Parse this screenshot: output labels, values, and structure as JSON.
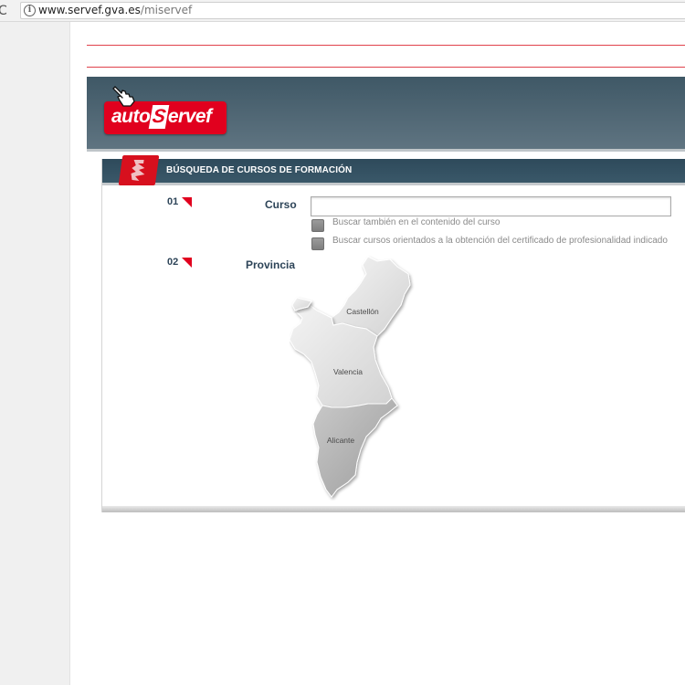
{
  "browser": {
    "url_domain": "www.servef.gva.es",
    "url_path": "/miservef"
  },
  "logo": {
    "text_before": "auto",
    "text_s": "S",
    "text_after": "ervef"
  },
  "panel": {
    "title": "BÚSQUEDA DE CURSOS DE FORMACIÓN",
    "step1": {
      "number": "01",
      "label": "Curso",
      "input_value": "",
      "options": [
        {
          "label": "Buscar también en el contenido del curso"
        },
        {
          "label": "Buscar cursos orientados a la obtención del certificado de profesionalidad indicado"
        }
      ]
    },
    "step2": {
      "number": "02",
      "label": "Provincia",
      "provinces": [
        {
          "name": "Castellón"
        },
        {
          "name": "Valencia"
        },
        {
          "name": "Alicante"
        }
      ]
    }
  },
  "colors": {
    "brand_red": "#e1001e",
    "banner_blue": "#4a6270",
    "label_navy": "#2d4458"
  }
}
